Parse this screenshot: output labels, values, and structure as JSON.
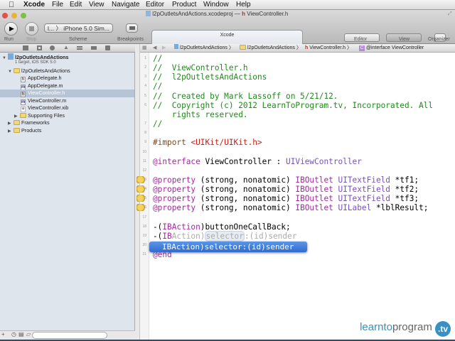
{
  "menubar": {
    "app": "Xcode",
    "items": [
      "File",
      "Edit",
      "View",
      "Navigate",
      "Editor",
      "Product",
      "Window",
      "Help"
    ]
  },
  "window": {
    "title_project": "l2pOutletsAndActions.xcodeproj",
    "title_sep": "—",
    "title_file": "ViewController.h"
  },
  "toolbar": {
    "run": "Run",
    "stop": "Stop",
    "scheme_value": "l... 〉 iPhone 5.0 Sim...",
    "scheme": "Scheme",
    "breakpoints": "Breakpoints",
    "activity": "Xcode",
    "editor": "Editor",
    "view": "View",
    "organizer": "Organizer"
  },
  "navigator": {
    "project": "l2pOutletsAndActions",
    "project_sub": "1 target, iOS SDK 5.0",
    "items": [
      {
        "label": "l2pOutletsAndActions",
        "kind": "folder"
      },
      {
        "label": "AppDelegate.h",
        "kind": "h"
      },
      {
        "label": "AppDelegate.m",
        "kind": "m"
      },
      {
        "label": "ViewController.h",
        "kind": "h"
      },
      {
        "label": "ViewController.m",
        "kind": "m"
      },
      {
        "label": "ViewController.xib",
        "kind": "xib"
      },
      {
        "label": "Supporting Files",
        "kind": "folder"
      },
      {
        "label": "Frameworks",
        "kind": "folder"
      },
      {
        "label": "Products",
        "kind": "folder"
      }
    ]
  },
  "jumpbar": {
    "items": [
      "l2pOutletsAndActions",
      "l2pOutletsAndActions",
      "ViewController.h",
      "@interface ViewController"
    ]
  },
  "code": {
    "line_numbers": [
      "1",
      "2",
      "3",
      "4",
      "5",
      "6",
      "",
      "7",
      "8",
      "9",
      "10",
      "11",
      "12",
      "13",
      "14",
      "15",
      "16",
      "17",
      "18",
      "19",
      "20",
      "21"
    ],
    "lines": [
      [
        [
          "cm",
          "//"
        ]
      ],
      [
        [
          "cm",
          "//  ViewController.h"
        ]
      ],
      [
        [
          "cm",
          "//  l2pOutletsAndActions"
        ]
      ],
      [
        [
          "cm",
          "//"
        ]
      ],
      [
        [
          "cm",
          "//  Created by Mark Lassoff on 5/21/12."
        ]
      ],
      [
        [
          "cm",
          "//  Copyright (c) 2012 LearnToProgram.tv, Incorporated. All"
        ]
      ],
      [
        [
          "cm",
          "    rights reserved."
        ]
      ],
      [
        [
          "cm",
          "//"
        ]
      ],
      [],
      [
        [
          "pp",
          "#import "
        ],
        [
          "st",
          "<UIKit/UIKit.h>"
        ]
      ],
      [],
      [
        [
          "kw",
          "@interface"
        ],
        [
          "tx",
          " ViewController : "
        ],
        [
          "ty",
          "UIViewController"
        ]
      ],
      [],
      [
        [
          "kw",
          "@property"
        ],
        [
          "tx",
          " (strong, nonatomic) "
        ],
        [
          "kw",
          "IBOutlet"
        ],
        [
          "tx",
          " "
        ],
        [
          "ty",
          "UITextField"
        ],
        [
          "tx",
          " *tf1;"
        ]
      ],
      [
        [
          "kw",
          "@property"
        ],
        [
          "tx",
          " (strong, nonatomic) "
        ],
        [
          "kw",
          "IBOutlet"
        ],
        [
          "tx",
          " "
        ],
        [
          "ty",
          "UITextField"
        ],
        [
          "tx",
          " *tf2;"
        ]
      ],
      [
        [
          "kw",
          "@property"
        ],
        [
          "tx",
          " (strong, nonatomic) "
        ],
        [
          "kw",
          "IBOutlet"
        ],
        [
          "tx",
          " "
        ],
        [
          "ty",
          "UITextField"
        ],
        [
          "tx",
          " *tf3;"
        ]
      ],
      [
        [
          "kw",
          "@property"
        ],
        [
          "tx",
          " (strong, nonatomic) "
        ],
        [
          "kw",
          "IBOutlet"
        ],
        [
          "tx",
          " "
        ],
        [
          "ty",
          "UILabel"
        ],
        [
          "tx",
          " *lblResult;"
        ]
      ],
      [],
      [
        [
          "tx",
          "-("
        ],
        [
          "kw",
          "IBAction"
        ],
        [
          "tx",
          ")buttonOneCallBack;"
        ]
      ],
      [
        [
          "tx",
          "-("
        ],
        [
          "kw",
          "IB"
        ],
        [
          "gh",
          "Action)"
        ],
        [
          "ph",
          "selector"
        ],
        [
          "gh",
          ":(id)sender"
        ]
      ],
      [],
      [
        [
          "kw",
          "@end"
        ]
      ]
    ],
    "warning_lines": [
      13,
      14,
      15,
      16
    ]
  },
  "autocomplete": {
    "suggestion": "IBAction)selector:(id)sender"
  },
  "brand": {
    "a": "learnto",
    "b": "program",
    "c": ".tv"
  }
}
